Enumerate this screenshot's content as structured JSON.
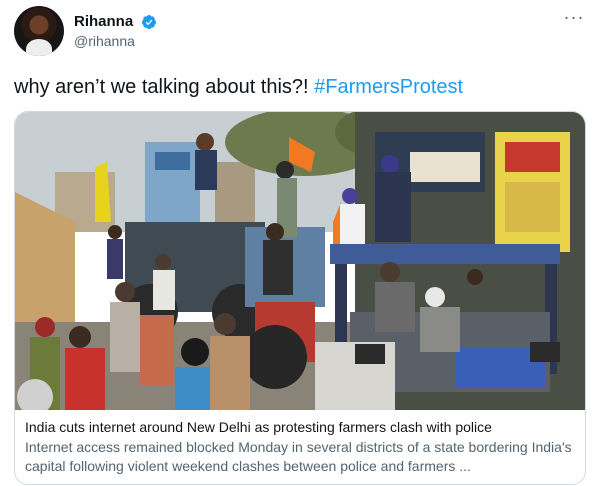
{
  "user": {
    "display_name": "Rihanna",
    "handle": "@rihanna"
  },
  "more_icon_label": "···",
  "tweet": {
    "text": "why aren’t we talking about this?! ",
    "hashtag": "#FarmersProtest"
  },
  "card": {
    "title": "India cuts internet around New Delhi as protesting farmers clash with police",
    "description": "Internet access remained blocked Monday in several districts of a state bordering India's capital following violent weekend clashes between police and farmers ..."
  },
  "colors": {
    "link": "#1d9bf0",
    "verified": "#1d9bf0",
    "secondary_text": "#536471",
    "border": "#cfd9de"
  },
  "icons": [
    "verified-badge-icon",
    "more-options-icon"
  ]
}
